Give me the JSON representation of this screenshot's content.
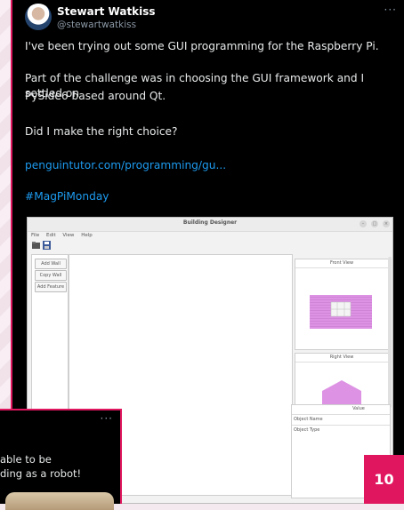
{
  "tweet": {
    "author_name": "Stewart Watkiss",
    "author_handle": "@stewartwatkiss",
    "more": "···",
    "paragraph1": "I've been trying out some GUI programming for the Raspberry Pi.",
    "paragraph2_line1": "Part of the challenge was in choosing the GUI framework and I settled on",
    "paragraph2_line2": "PySide6 based around Qt.",
    "paragraph3": "Did I make the right choice?",
    "link": "penguintutor.com/programming/gu...",
    "hashtag": "#MagPiMonday"
  },
  "app": {
    "title": "Building Designer",
    "menu": [
      "File",
      "Edit",
      "View",
      "Help"
    ],
    "buttons": [
      "Add Wall",
      "Copy Wall",
      "Add Feature"
    ],
    "front_view_label": "Front View",
    "right_view_label": "Right View",
    "value_header": "Value",
    "properties": [
      "Object Name",
      "Object Type"
    ]
  },
  "tweet2": {
    "more": "···",
    "line1": "able to be",
    "line2": "ding as a robot!"
  },
  "page_number": "10",
  "colors": {
    "accent": "#e0175f",
    "link": "#1d9bf0",
    "wall_pink": "#d98be0"
  }
}
